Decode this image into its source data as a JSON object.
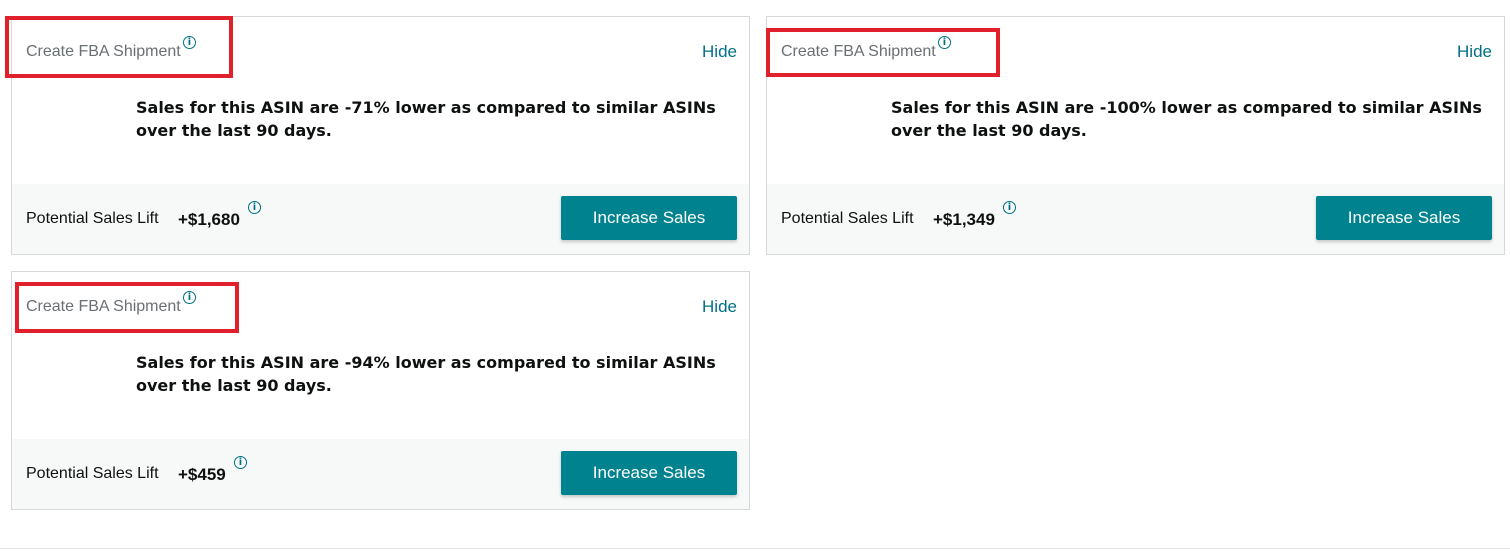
{
  "cards": [
    {
      "title": "Create FBA Shipment",
      "hide": "Hide",
      "message": "Sales for this ASIN are -71% lower as compared to similar ASINs over the last 90 days.",
      "lift_label": "Potential Sales Lift",
      "lift_value": "+$1,680",
      "button": "Increase Sales"
    },
    {
      "title": "Create FBA Shipment",
      "hide": "Hide",
      "message": "Sales for this ASIN are -100% lower as compared to similar ASINs over the last 90 days.",
      "lift_label": "Potential Sales Lift",
      "lift_value": "+$1,349",
      "button": "Increase Sales"
    },
    {
      "title": "Create FBA Shipment",
      "hide": "Hide",
      "message": "Sales for this ASIN are -94% lower as compared to similar ASINs over the last 90 days.",
      "lift_label": "Potential Sales Lift",
      "lift_value": "+$459",
      "button": "Increase Sales"
    }
  ],
  "icons": {
    "info": "info-circle-icon"
  },
  "colors": {
    "accent": "#007185",
    "button": "#00828f",
    "highlight": "#e0202a"
  }
}
